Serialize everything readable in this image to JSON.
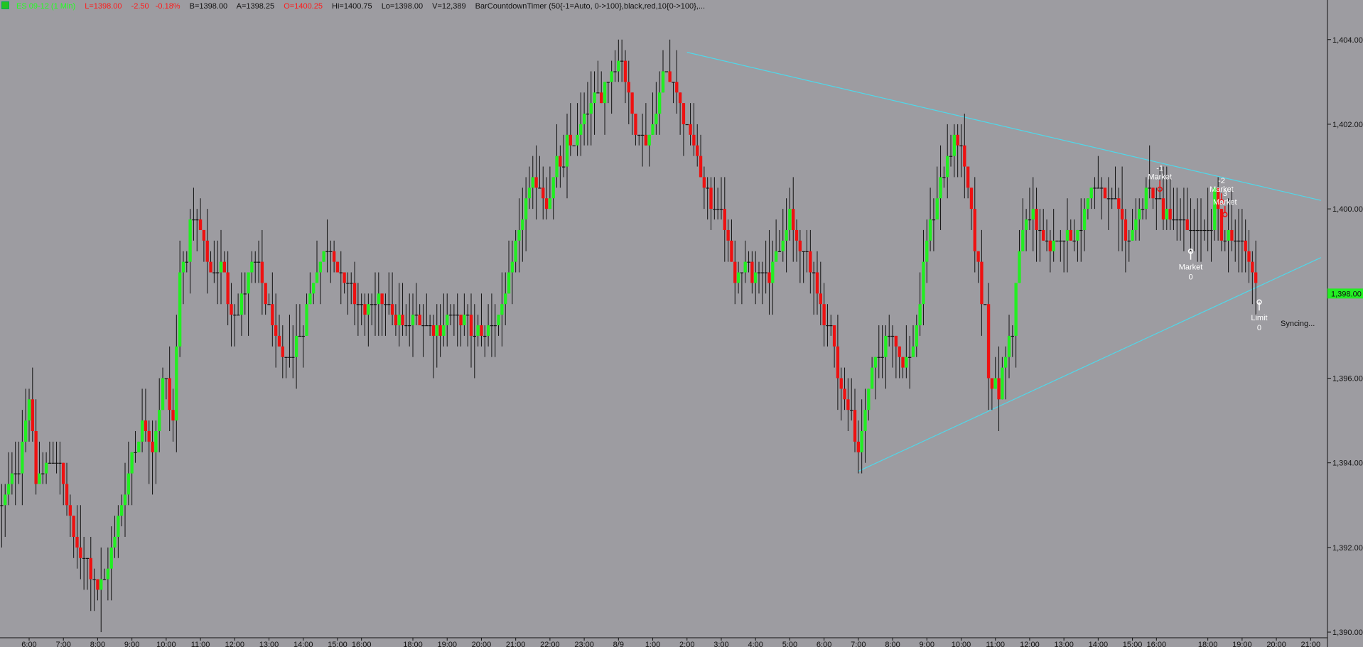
{
  "header": {
    "symbol": "ES 09-12 (1 Min)",
    "last": "L=1398.00",
    "change": "-2.50",
    "change_pct": "-0.18%",
    "bid": "B=1398.00",
    "ask": "A=1398.25",
    "open": "O=1400.25",
    "high": "Hi=1400.75",
    "low": "Lo=1398.00",
    "volume": "V=12,389",
    "indicator": "BarCountdownTimer (50{-1=Auto, 0->100},black,red,10{0->100},..."
  },
  "colors": {
    "background": "#9d9ca1",
    "up_bar": "#22ee22",
    "down_bar": "#ee1111",
    "neutral_bar": "#111111",
    "trendline": "#4fd8ea",
    "last_price_marker": "#22ee22",
    "positive_text": "#22ff22",
    "negative_text": "#ff1a1a"
  },
  "status": {
    "syncing": "Syncing..."
  },
  "last_price_label": "1,398.00",
  "chart_data": {
    "type": "candlestick",
    "title": "",
    "ylim": [
      1389.9,
      1404.6
    ],
    "y_ticks": [
      1390,
      1392,
      1394,
      1396,
      1398,
      1400,
      1402,
      1404
    ],
    "y_tick_labels": [
      "1,390.00",
      "1,392.00",
      "1,394.00",
      "1,396.00",
      "1,398.00",
      "1,400.00",
      "1,402.00",
      "1,404.00"
    ],
    "x_ticks": [
      "6:00",
      "7:00",
      "8:00",
      "9:00",
      "10:00",
      "11:00",
      "12:00",
      "13:00",
      "14:00",
      "15:00",
      "16:00",
      "18:00",
      "19:00",
      "20:00",
      "21:00",
      "22:00",
      "23:00",
      "8/9",
      "1:00",
      "2:00",
      "3:00",
      "4:00",
      "5:00",
      "6:00",
      "7:00",
      "8:00",
      "9:00",
      "10:00",
      "11:00",
      "12:00",
      "13:00",
      "14:00",
      "15:00",
      "16:00",
      "18:00",
      "19:00",
      "20:00",
      "21:00"
    ],
    "x_tick_index": [
      8,
      18,
      28,
      38,
      48,
      58,
      68,
      78,
      88,
      98,
      105,
      120,
      130,
      140,
      150,
      160,
      170,
      180,
      190,
      200,
      210,
      220,
      230,
      240,
      250,
      260,
      270,
      280,
      290,
      300,
      310,
      320,
      330,
      337,
      352,
      362,
      372,
      382
    ],
    "price_path": [
      [
        0,
        1393.0
      ],
      [
        5,
        1394.0
      ],
      [
        8,
        1395.5
      ],
      [
        10,
        1393.5
      ],
      [
        14,
        1394.0
      ],
      [
        17,
        1394.0
      ],
      [
        21,
        1392.2
      ],
      [
        24,
        1391.8
      ],
      [
        28,
        1391.0
      ],
      [
        31,
        1391.5
      ],
      [
        35,
        1393.0
      ],
      [
        38,
        1394.2
      ],
      [
        41,
        1395.0
      ],
      [
        44,
        1394.3
      ],
      [
        47,
        1396.0
      ],
      [
        50,
        1395.0
      ],
      [
        52,
        1398.5
      ],
      [
        55,
        1399.8
      ],
      [
        58,
        1399.5
      ],
      [
        61,
        1398.6
      ],
      [
        64,
        1398.7
      ],
      [
        68,
        1397.2
      ],
      [
        71,
        1398.3
      ],
      [
        74,
        1398.8
      ],
      [
        78,
        1397.6
      ],
      [
        82,
        1396.3
      ],
      [
        85,
        1396.8
      ],
      [
        88,
        1397.2
      ],
      [
        92,
        1398.7
      ],
      [
        95,
        1399.2
      ],
      [
        98,
        1398.6
      ],
      [
        102,
        1397.8
      ],
      [
        106,
        1397.5
      ],
      [
        110,
        1397.8
      ],
      [
        114,
        1397.4
      ],
      [
        118,
        1397.2
      ],
      [
        123,
        1397.4
      ],
      [
        127,
        1397.2
      ],
      [
        132,
        1397.5
      ],
      [
        137,
        1397.2
      ],
      [
        141,
        1397.0
      ],
      [
        145,
        1397.6
      ],
      [
        148,
        1398.3
      ],
      [
        151,
        1399.4
      ],
      [
        153,
        1400.3
      ],
      [
        156,
        1400.7
      ],
      [
        159,
        1400.2
      ],
      [
        162,
        1401.0
      ],
      [
        165,
        1401.5
      ],
      [
        168,
        1401.7
      ],
      [
        172,
        1402.5
      ],
      [
        175,
        1402.7
      ],
      [
        178,
        1403.2
      ],
      [
        181,
        1403.5
      ],
      [
        184,
        1402.2
      ],
      [
        187,
        1401.6
      ],
      [
        190,
        1402.0
      ],
      [
        193,
        1403.2
      ],
      [
        196,
        1403.0
      ],
      [
        199,
        1402.2
      ],
      [
        202,
        1401.5
      ],
      [
        205,
        1400.4
      ],
      [
        208,
        1400.0
      ],
      [
        211,
        1399.6
      ],
      [
        214,
        1398.3
      ],
      [
        217,
        1398.7
      ],
      [
        219,
        1398.3
      ],
      [
        221,
        1398.6
      ],
      [
        224,
        1398.4
      ],
      [
        227,
        1399.0
      ],
      [
        230,
        1399.8
      ],
      [
        232,
        1399.3
      ],
      [
        235,
        1398.7
      ],
      [
        238,
        1398.0
      ],
      [
        241,
        1397.2
      ],
      [
        244,
        1396.2
      ],
      [
        247,
        1395.1
      ],
      [
        250,
        1394.2
      ],
      [
        253,
        1395.8
      ],
      [
        256,
        1396.5
      ],
      [
        259,
        1397.0
      ],
      [
        262,
        1396.5
      ],
      [
        265,
        1396.5
      ],
      [
        268,
        1397.8
      ],
      [
        270,
        1399.3
      ],
      [
        273,
        1400.3
      ],
      [
        276,
        1401.2
      ],
      [
        279,
        1401.6
      ],
      [
        282,
        1400.5
      ],
      [
        285,
        1398.6
      ],
      [
        288,
        1396.2
      ],
      [
        291,
        1395.6
      ],
      [
        294,
        1397.0
      ],
      [
        297,
        1399.0
      ],
      [
        300,
        1400.2
      ],
      [
        303,
        1399.5
      ],
      [
        306,
        1398.9
      ],
      [
        309,
        1399.3
      ],
      [
        312,
        1399.5
      ],
      [
        316,
        1400.0
      ],
      [
        319,
        1400.6
      ],
      [
        322,
        1400.2
      ],
      [
        325,
        1400.0
      ],
      [
        328,
        1399.3
      ],
      [
        331,
        1399.8
      ],
      [
        334,
        1400.5
      ],
      [
        337,
        1400.2
      ],
      [
        340,
        1399.9
      ],
      [
        343,
        1399.5
      ],
      [
        346,
        1399.6
      ],
      [
        350,
        1399.4
      ],
      [
        352,
        1399.4
      ],
      [
        354,
        1400.5
      ],
      [
        356,
        1399.2
      ],
      [
        358,
        1399.5
      ],
      [
        360,
        1399.2
      ],
      [
        362,
        1399.0
      ],
      [
        364,
        1398.8
      ],
      [
        366,
        1398.2
      ]
    ],
    "trendlines": [
      {
        "from": [
          200,
          1403.7
        ],
        "to": [
          385,
          1400.2
        ]
      },
      {
        "from": [
          250,
          1393.8
        ],
        "to": [
          385,
          1398.85
        ]
      }
    ],
    "annotations": [
      {
        "label": "Market",
        "qty": "-1",
        "bar": 338,
        "price": 1400.5,
        "side": "above"
      },
      {
        "label": "Market",
        "qty": "-2",
        "bar": 356,
        "price": 1400.2,
        "side": "above"
      },
      {
        "label": "Market",
        "qty": "3",
        "bar": 357,
        "price": 1399.9,
        "side": "above"
      },
      {
        "label": "Market",
        "qty": "0",
        "bar": 347,
        "price": 1399.0,
        "side": "below"
      },
      {
        "label": "Limit",
        "qty": "0",
        "bar": 367,
        "price": 1397.8,
        "side": "below"
      }
    ]
  }
}
